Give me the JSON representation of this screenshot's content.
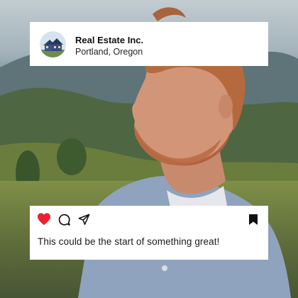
{
  "post": {
    "account_name": "Real Estate Inc.",
    "location": "Portland, Oregon",
    "caption": "This could be the start of something great!",
    "liked": true
  },
  "icons": {
    "avatar": "house-avatar-icon",
    "like": "heart-icon",
    "comment": "speech-bubble-icon",
    "share": "paper-plane-icon",
    "save": "bookmark-icon"
  },
  "colors": {
    "like": "#ee1f2e",
    "card_background": "#ffffff",
    "text": "#111111"
  }
}
